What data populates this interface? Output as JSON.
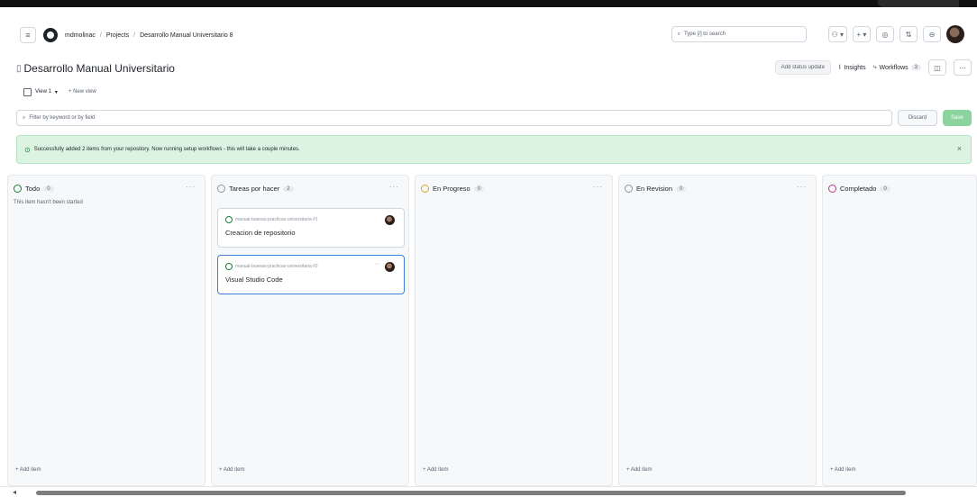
{
  "breadcrumb": {
    "owner": "mdmolinac",
    "section": "Projects",
    "project": "Desarrollo Manual Universitario 8"
  },
  "search": {
    "placeholder": "Type [/] to search"
  },
  "project": {
    "title": "Desarrollo Manual Universitario",
    "add_status_update": "Add status update",
    "insights_label": "Insights",
    "workflows_label": "Workflows",
    "workflows_count": "3"
  },
  "views": {
    "current": "View 1",
    "new_view": "New view"
  },
  "filter": {
    "placeholder": "Filter by keyword or by field",
    "discard_label": "Discard",
    "save_label": "Save"
  },
  "banner": {
    "message": "Successfully added 2 items from your repository. Now running setup workflows - this will take a couple minutes."
  },
  "columns": [
    {
      "name": "Todo",
      "count": "0",
      "description": "This item hasn't been started",
      "color": "#1a7f37",
      "add_label": "+ Add item",
      "cards": []
    },
    {
      "name": "Tareas por hacer",
      "count": "2",
      "description": "",
      "color": "#8c959f",
      "add_label": "+ Add item",
      "cards": [
        {
          "ref": "manual-buenas-practicas-universitaria #1",
          "title": "Creacion de repositorio"
        },
        {
          "ref": "manual-buenas-practicas-universitaria #2",
          "title": "Visual Studio Code"
        }
      ]
    },
    {
      "name": "En Progreso",
      "count": "0",
      "description": "",
      "color": "#d4a72c",
      "add_label": "+ Add item",
      "cards": []
    },
    {
      "name": "En Revision",
      "count": "0",
      "description": "",
      "color": "#8c959f",
      "add_label": "+ Add item",
      "cards": []
    },
    {
      "name": "Completado",
      "count": "0",
      "description": "",
      "color": "#bf3989",
      "add_label": "+ Add item",
      "cards": []
    }
  ]
}
